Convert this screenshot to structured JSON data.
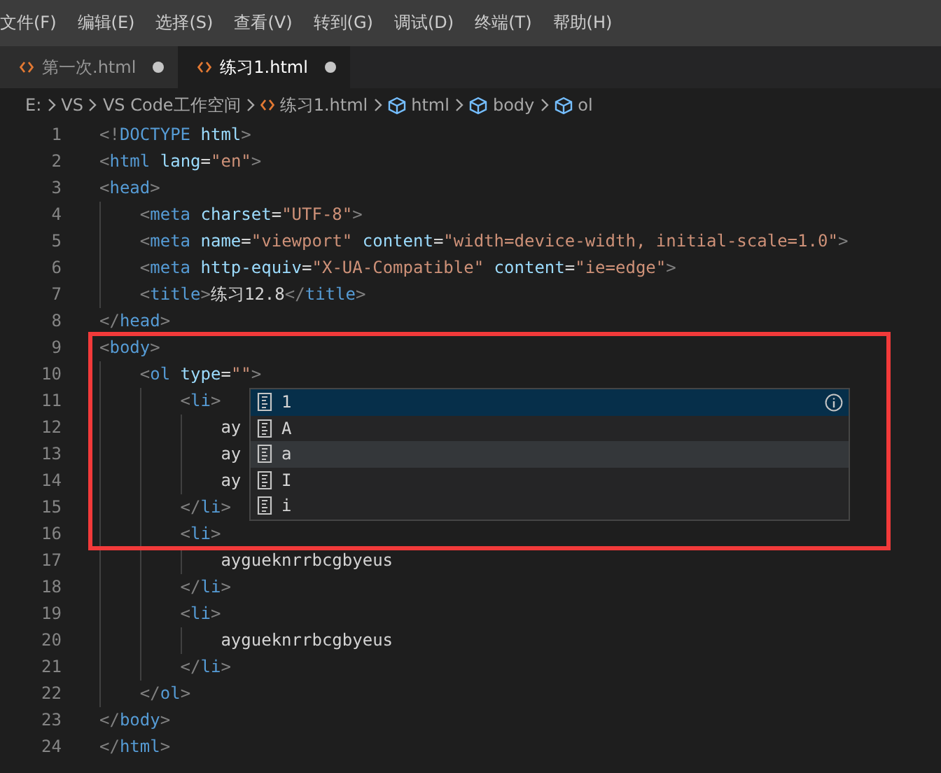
{
  "menu": [
    "文件(F)",
    "编辑(E)",
    "选择(S)",
    "查看(V)",
    "转到(G)",
    "调试(D)",
    "终端(T)",
    "帮助(H)"
  ],
  "tabs": [
    {
      "label": "第一次.html",
      "selected": false,
      "modified": true
    },
    {
      "label": "练习1.html",
      "selected": true,
      "modified": true
    }
  ],
  "breadcrumbs": [
    {
      "kind": "folder",
      "label": "E:"
    },
    {
      "kind": "folder",
      "label": "VS"
    },
    {
      "kind": "folder",
      "label": "VS Code工作空间"
    },
    {
      "kind": "file",
      "label": "练习1.html"
    },
    {
      "kind": "symbol",
      "label": "html"
    },
    {
      "kind": "symbol",
      "label": "body"
    },
    {
      "kind": "symbol",
      "label": "ol"
    }
  ],
  "editor": {
    "lines": [
      {
        "number": "1",
        "tokens": [
          {
            "kind": "punct",
            "text": "<!"
          },
          {
            "kind": "tag",
            "text": "DOCTYPE"
          },
          {
            "kind": "attr",
            "text": " html"
          },
          {
            "kind": "punct",
            "text": ">"
          }
        ]
      },
      {
        "number": "2",
        "tokens": [
          {
            "kind": "punct",
            "text": "<"
          },
          {
            "kind": "tag",
            "text": "html"
          },
          {
            "kind": "attr",
            "text": " lang"
          },
          {
            "kind": "text",
            "text": "="
          },
          {
            "kind": "string",
            "text": "\"en\""
          },
          {
            "kind": "punct",
            "text": ">"
          }
        ]
      },
      {
        "number": "3",
        "tokens": [
          {
            "kind": "punct",
            "text": "<"
          },
          {
            "kind": "tag",
            "text": "head"
          },
          {
            "kind": "punct",
            "text": ">"
          }
        ]
      },
      {
        "number": "4",
        "tokens": [
          {
            "kind": "punct",
            "text": "    <"
          },
          {
            "kind": "tag",
            "text": "meta"
          },
          {
            "kind": "attr",
            "text": " charset"
          },
          {
            "kind": "text",
            "text": "="
          },
          {
            "kind": "string",
            "text": "\"UTF-8\""
          },
          {
            "kind": "punct",
            "text": ">"
          }
        ]
      },
      {
        "number": "5",
        "tokens": [
          {
            "kind": "punct",
            "text": "    <"
          },
          {
            "kind": "tag",
            "text": "meta"
          },
          {
            "kind": "attr",
            "text": " name"
          },
          {
            "kind": "text",
            "text": "="
          },
          {
            "kind": "string",
            "text": "\"viewport\""
          },
          {
            "kind": "attr",
            "text": " content"
          },
          {
            "kind": "text",
            "text": "="
          },
          {
            "kind": "string",
            "text": "\"width=device-width, initial-scale=1.0\""
          },
          {
            "kind": "punct",
            "text": ">"
          }
        ]
      },
      {
        "number": "6",
        "tokens": [
          {
            "kind": "punct",
            "text": "    <"
          },
          {
            "kind": "tag",
            "text": "meta"
          },
          {
            "kind": "attr",
            "text": " http-equiv"
          },
          {
            "kind": "text",
            "text": "="
          },
          {
            "kind": "string",
            "text": "\"X-UA-Compatible\""
          },
          {
            "kind": "attr",
            "text": " content"
          },
          {
            "kind": "text",
            "text": "="
          },
          {
            "kind": "string",
            "text": "\"ie=edge\""
          },
          {
            "kind": "punct",
            "text": ">"
          }
        ]
      },
      {
        "number": "7",
        "tokens": [
          {
            "kind": "punct",
            "text": "    <"
          },
          {
            "kind": "tag",
            "text": "title"
          },
          {
            "kind": "punct",
            "text": ">"
          },
          {
            "kind": "text",
            "text": "练习12.8"
          },
          {
            "kind": "punct",
            "text": "</"
          },
          {
            "kind": "tag",
            "text": "title"
          },
          {
            "kind": "punct",
            "text": ">"
          }
        ]
      },
      {
        "number": "8",
        "tokens": [
          {
            "kind": "punct",
            "text": "</"
          },
          {
            "kind": "tag",
            "text": "head"
          },
          {
            "kind": "punct",
            "text": ">"
          }
        ]
      },
      {
        "number": "9",
        "tokens": [
          {
            "kind": "punct",
            "text": "<"
          },
          {
            "kind": "tag",
            "text": "body"
          },
          {
            "kind": "punct",
            "text": ">"
          }
        ]
      },
      {
        "number": "10",
        "tokens": [
          {
            "kind": "punct",
            "text": "    <"
          },
          {
            "kind": "tag",
            "text": "ol"
          },
          {
            "kind": "attr",
            "text": " type"
          },
          {
            "kind": "text",
            "text": "="
          },
          {
            "kind": "string",
            "text": "\"\""
          },
          {
            "kind": "punct",
            "text": ">"
          }
        ]
      },
      {
        "number": "11",
        "tokens": [
          {
            "kind": "punct",
            "text": "        <"
          },
          {
            "kind": "tag",
            "text": "li"
          },
          {
            "kind": "punct",
            "text": ">"
          }
        ]
      },
      {
        "number": "12",
        "tokens": [
          {
            "kind": "text",
            "text": "            ay"
          }
        ]
      },
      {
        "number": "13",
        "tokens": [
          {
            "kind": "text",
            "text": "            ay"
          }
        ]
      },
      {
        "number": "14",
        "tokens": [
          {
            "kind": "text",
            "text": "            ay"
          }
        ]
      },
      {
        "number": "15",
        "tokens": [
          {
            "kind": "punct",
            "text": "        </"
          },
          {
            "kind": "tag",
            "text": "li"
          },
          {
            "kind": "punct",
            "text": ">"
          }
        ]
      },
      {
        "number": "16",
        "tokens": [
          {
            "kind": "punct",
            "text": "        <"
          },
          {
            "kind": "tag",
            "text": "li"
          },
          {
            "kind": "punct",
            "text": ">"
          }
        ]
      },
      {
        "number": "17",
        "tokens": [
          {
            "kind": "text",
            "text": "            aygueknrrbcgbyeus"
          }
        ]
      },
      {
        "number": "18",
        "tokens": [
          {
            "kind": "punct",
            "text": "        </"
          },
          {
            "kind": "tag",
            "text": "li"
          },
          {
            "kind": "punct",
            "text": ">"
          }
        ]
      },
      {
        "number": "19",
        "tokens": [
          {
            "kind": "punct",
            "text": "        <"
          },
          {
            "kind": "tag",
            "text": "li"
          },
          {
            "kind": "punct",
            "text": ">"
          }
        ]
      },
      {
        "number": "20",
        "tokens": [
          {
            "kind": "text",
            "text": "            aygueknrrbcgbyeus"
          }
        ]
      },
      {
        "number": "21",
        "tokens": [
          {
            "kind": "punct",
            "text": "        </"
          },
          {
            "kind": "tag",
            "text": "li"
          },
          {
            "kind": "punct",
            "text": ">"
          }
        ]
      },
      {
        "number": "22",
        "tokens": [
          {
            "kind": "punct",
            "text": "    </"
          },
          {
            "kind": "tag",
            "text": "ol"
          },
          {
            "kind": "punct",
            "text": ">"
          }
        ]
      },
      {
        "number": "23",
        "tokens": [
          {
            "kind": "punct",
            "text": "</"
          },
          {
            "kind": "tag",
            "text": "body"
          },
          {
            "kind": "punct",
            "text": ">"
          }
        ]
      },
      {
        "number": "24",
        "tokens": [
          {
            "kind": "punct",
            "text": "</"
          },
          {
            "kind": "tag",
            "text": "html"
          },
          {
            "kind": "punct",
            "text": ">"
          }
        ]
      }
    ]
  },
  "suggestions": [
    {
      "label": "1",
      "selected": true,
      "hovered": false
    },
    {
      "label": "A",
      "selected": false,
      "hovered": false
    },
    {
      "label": "a",
      "selected": false,
      "hovered": true
    },
    {
      "label": "I",
      "selected": false,
      "hovered": false
    },
    {
      "label": "i",
      "selected": false,
      "hovered": false
    }
  ]
}
